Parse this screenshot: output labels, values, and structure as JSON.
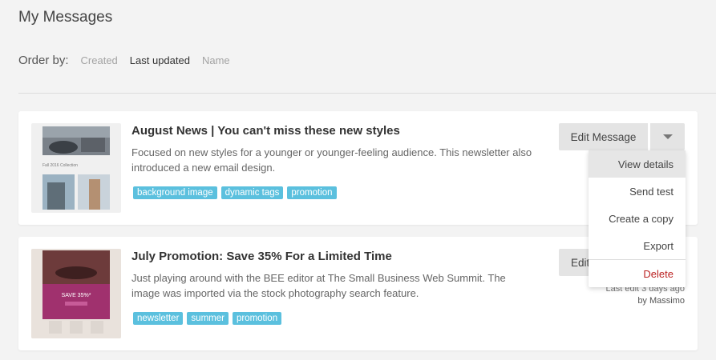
{
  "page": {
    "title": "My Messages"
  },
  "order": {
    "label": "Order by:",
    "options": [
      "Created",
      "Last updated",
      "Name"
    ],
    "active": "Last updated"
  },
  "messages": [
    {
      "title": "August News | You can't miss these new styles",
      "description": "Focused on new styles for a younger or younger-feeling audience. This newsletter also introduced a new email design.",
      "tags": [
        "background image",
        "dynamic tags",
        "promotion"
      ],
      "edit_label": "Edit Message",
      "thumb_caption": "Fall 2016 Collection"
    },
    {
      "title": "July Promotion: Save 35% For a Limited Time",
      "description": "Just playing around with the BEE editor at The Small Business Web Summit. The image was imported via the stock photography search feature.",
      "tags": [
        "newsletter",
        "summer",
        "promotion"
      ],
      "edit_label": "Edit",
      "last_edit": "Last edit 3 days ago",
      "author": "by Massimo",
      "thumb_caption": "SAVE 35%*"
    }
  ],
  "dropdown": {
    "items": [
      "View details",
      "Send test",
      "Create a copy",
      "Export",
      "Delete"
    ]
  },
  "colors": {
    "tag": "#5bc0de",
    "danger": "#b22222",
    "background": "#f3f3f3"
  }
}
